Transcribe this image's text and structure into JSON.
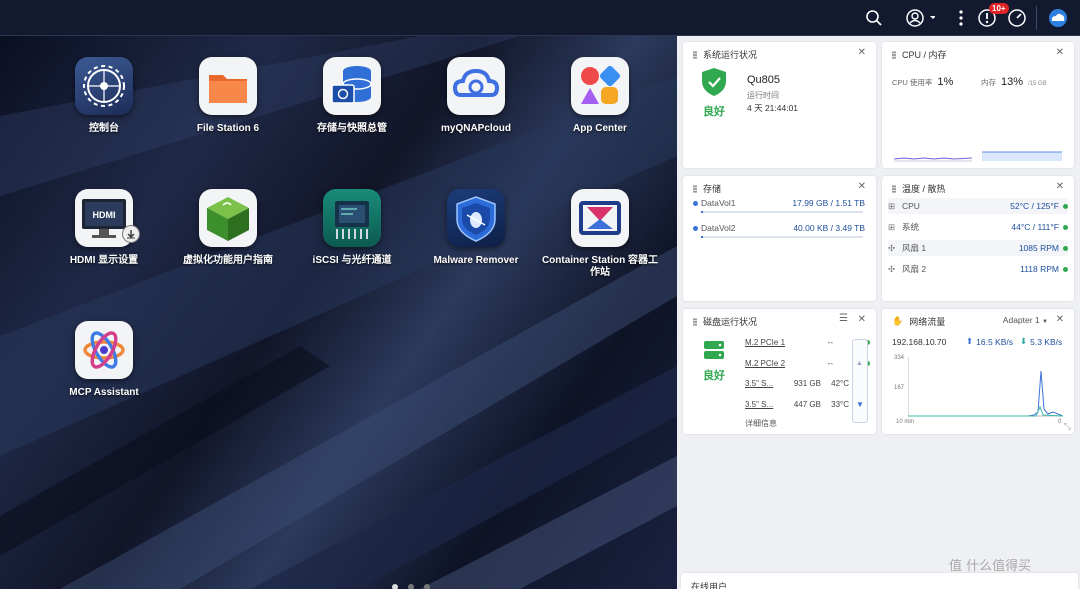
{
  "topbar": {
    "icons": [
      "search-icon",
      "account-icon",
      "more-icon",
      "notification-icon",
      "resource-monitor-icon",
      "cloud-icon"
    ],
    "notification_badge": "10+"
  },
  "apps": [
    {
      "label": "控制台",
      "icon": "settings-gear-icon"
    },
    {
      "label": "File Station 6",
      "icon": "folder-icon"
    },
    {
      "label": "存储与快照总管",
      "icon": "storage-database-icon"
    },
    {
      "label": "myQNAPcloud",
      "icon": "cloud-icon"
    },
    {
      "label": "App Center",
      "icon": "app-grid-icon"
    },
    {
      "label": "HDMI 显示设置",
      "icon": "hdmi-monitor-icon"
    },
    {
      "label": "虚拟化功能用户指南",
      "icon": "cube-icon"
    },
    {
      "label": "iSCSI 与光纤通道",
      "icon": "chip-icon"
    },
    {
      "label": "Malware Remover",
      "icon": "shield-bug-icon"
    },
    {
      "label": "Container Station 容器工作站",
      "icon": "container-icon"
    },
    {
      "label": "MCP Assistant",
      "icon": "atom-icon"
    }
  ],
  "widgets": {
    "system": {
      "title": "系统运行状况",
      "status": "良好",
      "hostname": "Qu805",
      "uptime_label": "运行时间",
      "uptime": "4 天 21:44:01"
    },
    "cpu": {
      "title": "CPU / 内存",
      "cpu_label": "CPU 使用率",
      "cpu_value": "1%",
      "mem_label": "内存",
      "mem_value": "13%",
      "mem_total": "/15 GB"
    },
    "storage": {
      "title": "存储",
      "volumes": [
        {
          "name": "DataVol1",
          "usage": "17.99 GB / 1.51 TB",
          "pct": 0.012
        },
        {
          "name": "DataVol2",
          "usage": "40.00 KB / 3.49 TB",
          "pct": 0.001
        }
      ]
    },
    "temp": {
      "title": "温度 / 散热",
      "rows": [
        {
          "name": "CPU",
          "value": "52°C / 125°F"
        },
        {
          "name": "系统",
          "value": "44°C / 111°F"
        },
        {
          "name": "风扇 1",
          "value": "1085 RPM"
        },
        {
          "name": "风扇 2",
          "value": "1118 RPM"
        }
      ]
    },
    "disk": {
      "title": "磁盘运行状况",
      "status": "良好",
      "rows": [
        {
          "name": "M.2 PCIe 1",
          "size": "--",
          "temp": "--"
        },
        {
          "name": "M.2 PCIe 2",
          "size": "--",
          "temp": "--"
        },
        {
          "name": "3.5\" S...",
          "size": "931 GB",
          "temp": "42°C"
        },
        {
          "name": "3.5\" S...",
          "size": "447 GB",
          "temp": "33°C"
        }
      ],
      "details": "详细信息"
    },
    "network": {
      "title": "网络流量",
      "adapter": "Adapter 1",
      "ip": "192.168.10.70",
      "up": "16.5 KB/s",
      "down": "5.3 KB/s",
      "y_max": "334",
      "y_mid": "167",
      "x_left": "10 min",
      "x_right": "0"
    }
  },
  "online_users": {
    "title": "在线用户"
  },
  "watermark": "值 什么值得买"
}
